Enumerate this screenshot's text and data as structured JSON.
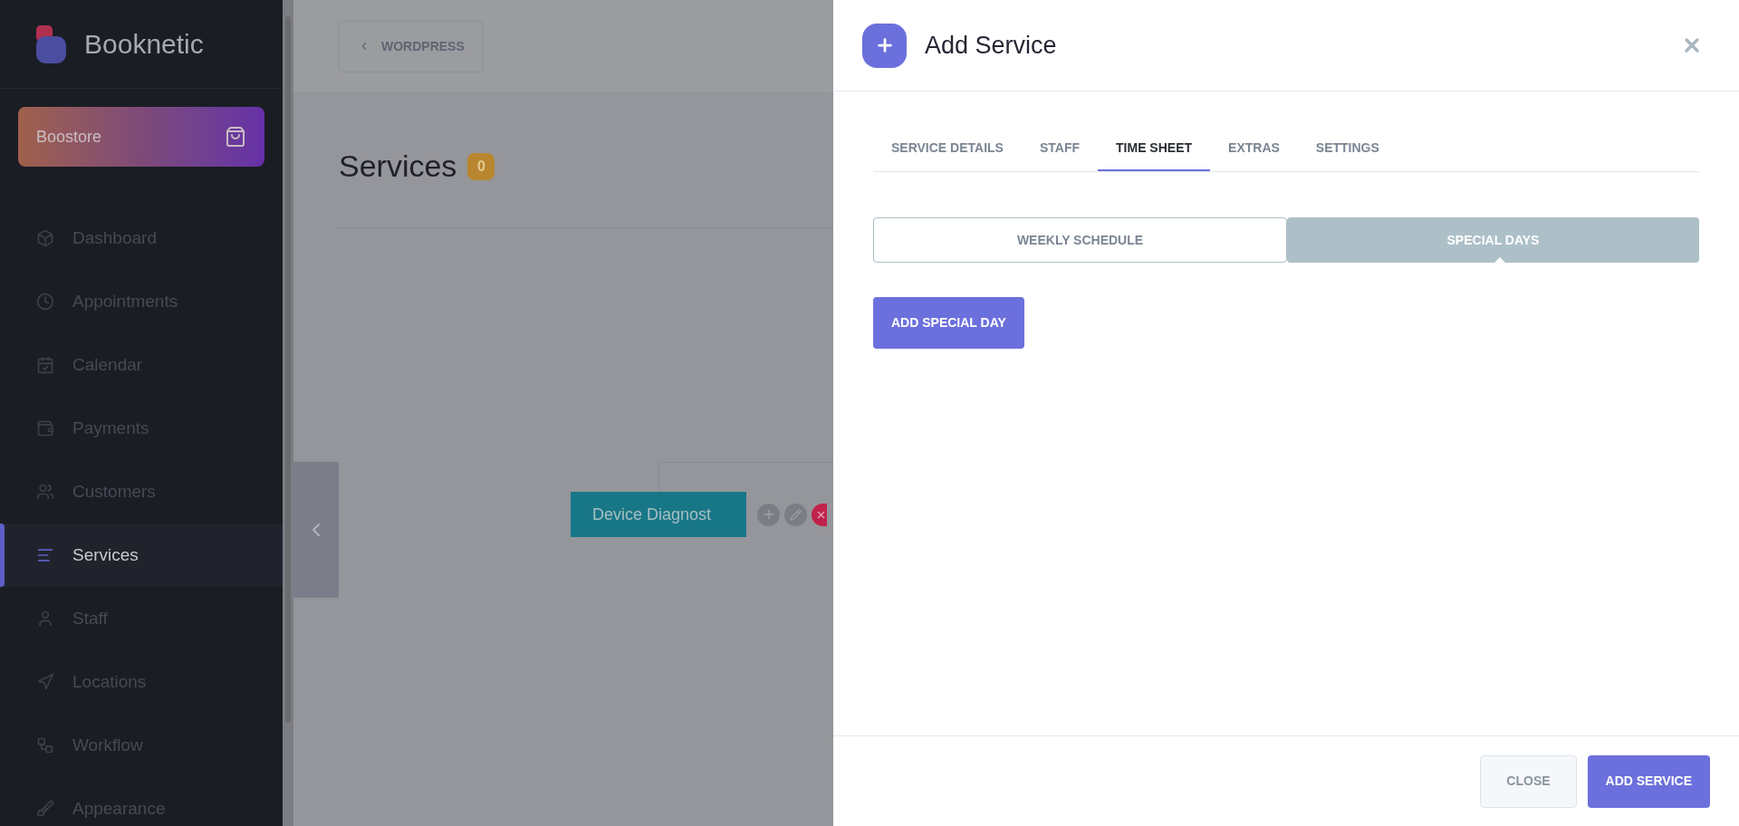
{
  "sidebar": {
    "brand": "Booknetic",
    "store_button": "Boostore",
    "items": [
      {
        "label": "Dashboard",
        "selected": false
      },
      {
        "label": "Appointments",
        "selected": false
      },
      {
        "label": "Calendar",
        "selected": false
      },
      {
        "label": "Payments",
        "selected": false
      },
      {
        "label": "Customers",
        "selected": false
      },
      {
        "label": "Services",
        "selected": true
      },
      {
        "label": "Staff",
        "selected": false
      },
      {
        "label": "Locations",
        "selected": false
      },
      {
        "label": "Workflow",
        "selected": false
      },
      {
        "label": "Appearance",
        "selected": false
      }
    ]
  },
  "main": {
    "back_button": "WORDPRESS",
    "title": "Services",
    "count": "0",
    "node": "Device Diagnost"
  },
  "modal": {
    "title": "Add Service",
    "tabs": [
      {
        "label": "SERVICE DETAILS",
        "selected": false
      },
      {
        "label": "STAFF",
        "selected": false
      },
      {
        "label": "TIME SHEET",
        "selected": true
      },
      {
        "label": "EXTRAS",
        "selected": false
      },
      {
        "label": "SETTINGS",
        "selected": false
      }
    ],
    "schedule_tabs": [
      {
        "label": "WEEKLY SCHEDULE",
        "selected": false
      },
      {
        "label": "SPECIAL DAYS",
        "selected": true
      }
    ],
    "add_special_day": "ADD SPECIAL DAY",
    "footer_buttons": [
      {
        "label": "CLOSE",
        "kind": "secondary"
      },
      {
        "label": "ADD SERVICE",
        "kind": "primary"
      }
    ]
  }
}
